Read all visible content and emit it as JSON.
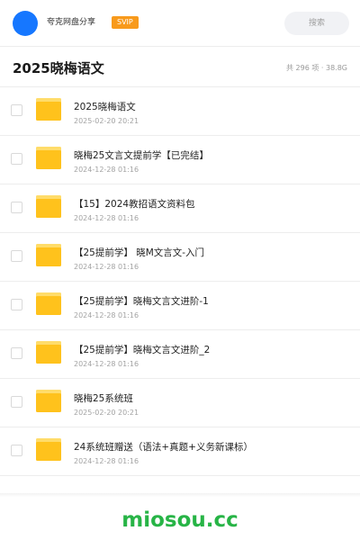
{
  "header": {
    "username": "夸克网盘分享",
    "badge": "SVIP",
    "search_placeholder": "搜索"
  },
  "folder": {
    "title": "2025晓梅语文",
    "summary": "共 296 项 · 38.8G"
  },
  "colors": {
    "avatar": "#1677ff",
    "badge": "#f89a1c",
    "folder_icon": "#ffc21c",
    "watermark": "#27b446"
  },
  "items": [
    {
      "name": "2025晓梅语文",
      "date": "2025-02-20 20:21",
      "icon": "folder-icon"
    },
    {
      "name": "晓梅25文言文提前学【已完结】",
      "date": "2024-12-28 01:16",
      "icon": "folder-icon"
    },
    {
      "name": "【15】2024教招语文资料包",
      "date": "2024-12-28 01:16",
      "icon": "folder-icon"
    },
    {
      "name": "【25提前学】 晓M文言文-入门",
      "date": "2024-12-28 01:16",
      "icon": "folder-icon"
    },
    {
      "name": "【25提前学】晓梅文言文进阶-1",
      "date": "2024-12-28 01:16",
      "icon": "folder-icon"
    },
    {
      "name": "【25提前学】晓梅文言文进阶_2",
      "date": "2024-12-28 01:16",
      "icon": "folder-icon"
    },
    {
      "name": "晓梅25系统班",
      "date": "2025-02-20 20:21",
      "icon": "folder-icon"
    },
    {
      "name": "24系统班赠送（语法+真题+义务新课标）",
      "date": "2024-12-28 01:16",
      "icon": "folder-icon"
    }
  ],
  "watermark": "miosou.cc"
}
